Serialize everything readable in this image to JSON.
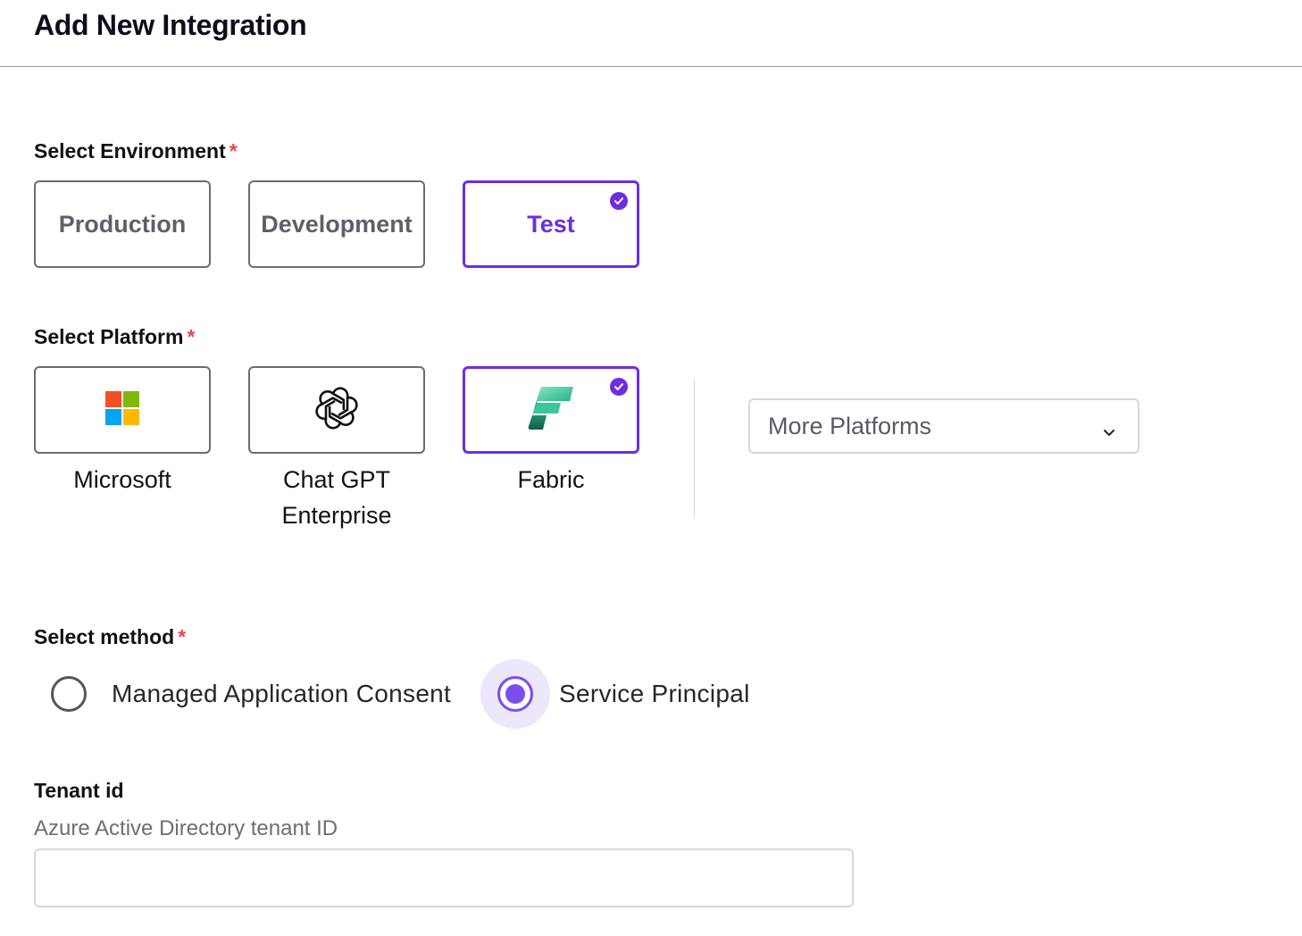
{
  "header": {
    "title": "Add New Integration"
  },
  "environment": {
    "label": "Select Environment",
    "required_mark": "*",
    "options": [
      {
        "label": "Production",
        "selected": false
      },
      {
        "label": "Development",
        "selected": false
      },
      {
        "label": "Test",
        "selected": true
      }
    ]
  },
  "platform": {
    "label": "Select Platform",
    "required_mark": "*",
    "options": [
      {
        "label": "Microsoft",
        "icon": "microsoft-logo-icon",
        "selected": false
      },
      {
        "label_line1": "Chat GPT",
        "label_line2": "Enterprise",
        "icon": "openai-logo-icon",
        "selected": false
      },
      {
        "label": "Fabric",
        "icon": "fabric-logo-icon",
        "selected": true
      }
    ],
    "more_dropdown": {
      "value": "More Platforms",
      "icon": "chevron-down-icon"
    }
  },
  "method": {
    "label": "Select method",
    "required_mark": "*",
    "options": [
      {
        "label": "Managed Application Consent",
        "selected": false
      },
      {
        "label": "Service Principal",
        "selected": true
      }
    ]
  },
  "tenant": {
    "label": "Tenant id",
    "help": "Azure Active Directory tenant ID",
    "value": ""
  },
  "colors": {
    "accent": "#6d2de0",
    "required": "#e5484d",
    "radio_accent": "#7c4dee"
  }
}
